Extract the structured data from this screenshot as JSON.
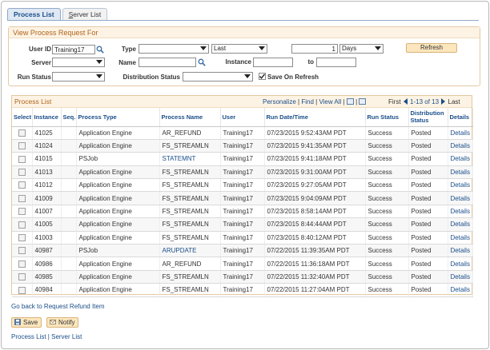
{
  "tabs": [
    {
      "label": "Process List",
      "active": true
    },
    {
      "label": "Server List",
      "underline": "S",
      "rest": "erver List",
      "active": false
    }
  ],
  "request": {
    "title": "View Process Request For",
    "user_id_label": "User ID",
    "user_id_value": "Training17",
    "type_label": "Type",
    "type_value": "",
    "last_value": "Last",
    "last_count": "1",
    "unit_value": "Days",
    "refresh_label": "Refresh",
    "server_label": "Server",
    "server_value": "",
    "name_label": "Name",
    "name_value": "",
    "instance_label": "Instance",
    "instance_from": "",
    "to_label": "to",
    "instance_to": "",
    "run_status_label": "Run Status",
    "run_status_value": "",
    "dist_status_label": "Distribution Status",
    "dist_status_value": "",
    "save_on_refresh_label": "Save On Refresh",
    "save_on_refresh_checked": true
  },
  "process_list": {
    "title": "Process List",
    "personalize": "Personalize",
    "find": "Find",
    "view_all": "View All",
    "first": "First",
    "range": "1-13 of 13",
    "last": "Last",
    "columns": [
      "Select",
      "Instance",
      "Seq.",
      "Process Type",
      "Process Name",
      "User",
      "Run Date/Time",
      "Run Status",
      "Distribution Status",
      "Details"
    ],
    "rows": [
      {
        "instance": "41025",
        "seq": "",
        "type": "Application Engine",
        "name": "AR_REFUND",
        "name_link": false,
        "user": "Training17",
        "datetime": "07/23/2015  9:52:43AM PDT",
        "run_status": "Success",
        "dist_status": "Posted",
        "details": "Details"
      },
      {
        "instance": "41024",
        "seq": "",
        "type": "Application Engine",
        "name": "FS_STREAMLN",
        "name_link": false,
        "user": "Training17",
        "datetime": "07/23/2015  9:41:35AM PDT",
        "run_status": "Success",
        "dist_status": "Posted",
        "details": "Details"
      },
      {
        "instance": "41015",
        "seq": "",
        "type": "PSJob",
        "name": "STATEMNT",
        "name_link": true,
        "user": "Training17",
        "datetime": "07/23/2015  9:41:18AM PDT",
        "run_status": "Success",
        "dist_status": "Posted",
        "details": "Details"
      },
      {
        "instance": "41013",
        "seq": "",
        "type": "Application Engine",
        "name": "FS_STREAMLN",
        "name_link": false,
        "user": "Training17",
        "datetime": "07/23/2015  9:31:00AM PDT",
        "run_status": "Success",
        "dist_status": "Posted",
        "details": "Details"
      },
      {
        "instance": "41012",
        "seq": "",
        "type": "Application Engine",
        "name": "FS_STREAMLN",
        "name_link": false,
        "user": "Training17",
        "datetime": "07/23/2015  9:27:05AM PDT",
        "run_status": "Success",
        "dist_status": "Posted",
        "details": "Details"
      },
      {
        "instance": "41009",
        "seq": "",
        "type": "Application Engine",
        "name": "FS_STREAMLN",
        "name_link": false,
        "user": "Training17",
        "datetime": "07/23/2015  9:04:09AM PDT",
        "run_status": "Success",
        "dist_status": "Posted",
        "details": "Details"
      },
      {
        "instance": "41007",
        "seq": "",
        "type": "Application Engine",
        "name": "FS_STREAMLN",
        "name_link": false,
        "user": "Training17",
        "datetime": "07/23/2015  8:58:14AM PDT",
        "run_status": "Success",
        "dist_status": "Posted",
        "details": "Details"
      },
      {
        "instance": "41005",
        "seq": "",
        "type": "Application Engine",
        "name": "FS_STREAMLN",
        "name_link": false,
        "user": "Training17",
        "datetime": "07/23/2015  8:44:44AM PDT",
        "run_status": "Success",
        "dist_status": "Posted",
        "details": "Details"
      },
      {
        "instance": "41003",
        "seq": "",
        "type": "Application Engine",
        "name": "FS_STREAMLN",
        "name_link": false,
        "user": "Training17",
        "datetime": "07/23/2015  8:40:12AM PDT",
        "run_status": "Success",
        "dist_status": "Posted",
        "details": "Details"
      },
      {
        "instance": "40987",
        "seq": "",
        "type": "PSJob",
        "name": "ARUPDATE",
        "name_link": true,
        "user": "Training17",
        "datetime": "07/22/2015 11:39:35AM PDT",
        "run_status": "Success",
        "dist_status": "Posted",
        "details": "Details"
      },
      {
        "instance": "40986",
        "seq": "",
        "type": "Application Engine",
        "name": "AR_REFUND",
        "name_link": false,
        "user": "Training17",
        "datetime": "07/22/2015 11:36:18AM PDT",
        "run_status": "Success",
        "dist_status": "Posted",
        "details": "Details"
      },
      {
        "instance": "40985",
        "seq": "",
        "type": "Application Engine",
        "name": "FS_STREAMLN",
        "name_link": false,
        "user": "Training17",
        "datetime": "07/22/2015 11:32:40AM PDT",
        "run_status": "Success",
        "dist_status": "Posted",
        "details": "Details"
      },
      {
        "instance": "40984",
        "seq": "",
        "type": "Application Engine",
        "name": "FS_STREAMLN",
        "name_link": false,
        "user": "Training17",
        "datetime": "07/22/2015 11:27:04AM PDT",
        "run_status": "Success",
        "dist_status": "Posted",
        "details": "Details"
      }
    ]
  },
  "back_link": "Go back to Request Refund Item",
  "toolbar": {
    "save_label": "Save",
    "notify_label": "Notify"
  },
  "footer": {
    "process_list": "Process List",
    "separator": " | ",
    "server_list": "Server List"
  },
  "colors": {
    "link": "#1a4e8a",
    "group_title": "#b0631a",
    "group_bg": "#fdf3e4",
    "button_bg": "#fbe6bd"
  }
}
